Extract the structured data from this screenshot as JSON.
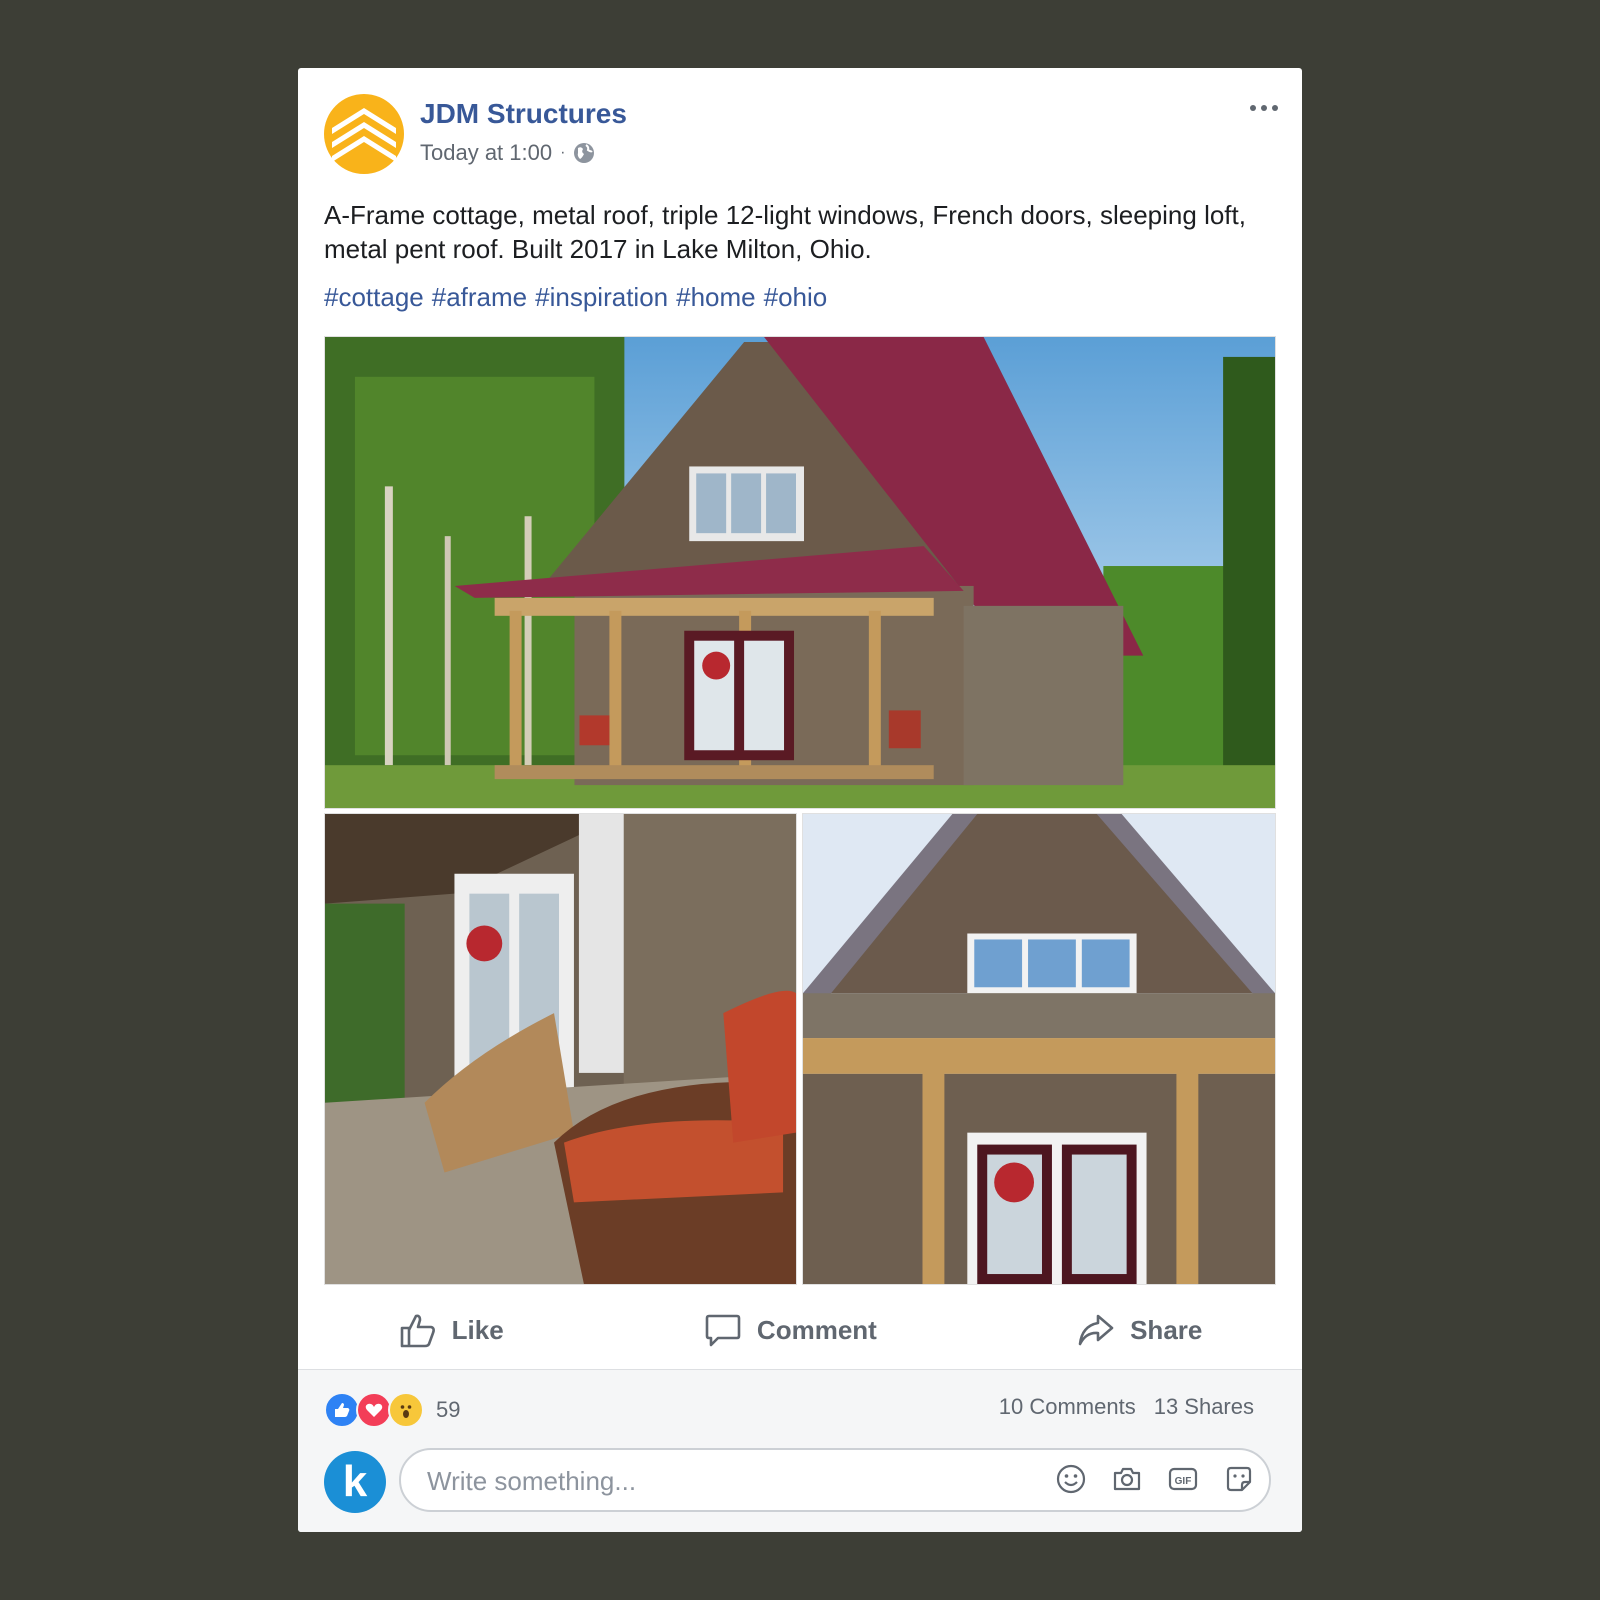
{
  "post": {
    "page_name": "JDM Structures",
    "timestamp": "Today at 1:00",
    "separator": "·",
    "privacy_icon": "globe-icon",
    "text": "A-Frame cottage, metal roof, triple 12-light windows, French doors, sleeping loft, metal pent roof. Built 2017 in Lake Milton, Ohio.",
    "hashtags": [
      "#cottage",
      "#aframe",
      "#inspiration",
      "#home",
      "#ohio"
    ],
    "photos": [
      "a-frame-cottage-front-view",
      "porch-rocking-chairs",
      "gable-front-door"
    ]
  },
  "actions": {
    "like": "Like",
    "comment": "Comment",
    "share": "Share"
  },
  "stats": {
    "reactions": [
      "like-reaction-icon",
      "love-reaction-icon",
      "wow-reaction-icon"
    ],
    "reaction_count": "59",
    "comments": "10 Comments",
    "shares": "13 Shares"
  },
  "composer": {
    "avatar_letter": "k",
    "placeholder": "Write something...",
    "tools": [
      "emoji-icon",
      "camera-icon",
      "gif-icon",
      "sticker-icon"
    ]
  },
  "colors": {
    "brand_blue": "#385898",
    "logo_yellow": "#f9b31a",
    "background": "#3d3e36"
  }
}
